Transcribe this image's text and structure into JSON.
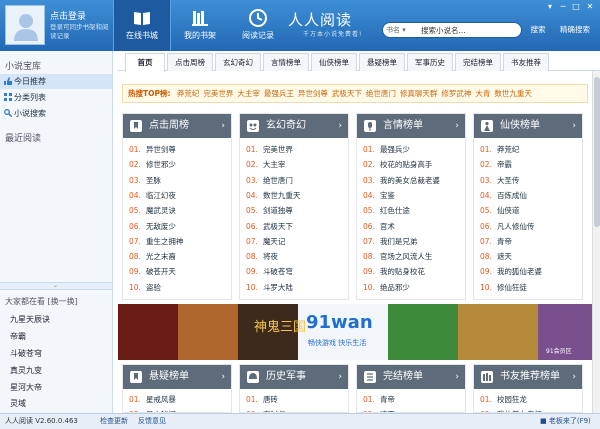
{
  "header": {
    "login_title": "点击登录",
    "login_sub": "登录可同步书架和阅读记录",
    "brand": "人人阅读",
    "brand_sub": "千万本小说免费看!",
    "nav": [
      {
        "label": "在线书城",
        "icon": "book-icon",
        "active": true
      },
      {
        "label": "我的书架",
        "icon": "bookshelf-icon",
        "active": false
      },
      {
        "label": "阅读记录",
        "icon": "clock-icon",
        "active": false
      }
    ],
    "search": {
      "scope": "书名 ▾",
      "value": "搜索小说名...",
      "search_label": "搜索",
      "exact_label": "精确搜索"
    },
    "window_controls": [
      "▾",
      "─",
      "□",
      "✕"
    ]
  },
  "sidebar": {
    "library_title": "小说宝库",
    "items": [
      {
        "label": "今日推荐",
        "icon": "thumbs-up-icon",
        "active": true
      },
      {
        "label": "分类列表",
        "icon": "grid-icon",
        "active": false
      },
      {
        "label": "小说搜索",
        "icon": "search-icon",
        "active": false
      }
    ],
    "recent_title": "最近阅读",
    "divider": "⌄",
    "hot_title": "大家都在看 [换一换]",
    "hot_items": [
      "九星天辰诀",
      "帝霸",
      "斗破苍穹",
      "真灵九变",
      "星河大帝",
      "灵域"
    ]
  },
  "tabs": [
    "首页",
    "点击周榜",
    "玄幻奇幻",
    "言情榜单",
    "仙侠榜单",
    "悬疑榜单",
    "军事历史",
    "完结榜单",
    "书友推荐"
  ],
  "hot_top": {
    "label": "热搜TOP榜:",
    "items": [
      "莽荒纪",
      "完美世界",
      "大主宰",
      "最强兵王",
      "异世剑尊",
      "武极天下",
      "绝世唐门",
      "修真聊天群",
      "修罗武神",
      "大青",
      "数世九重天"
    ]
  },
  "panels": [
    {
      "title": "点击周榜",
      "icon": "bookmark-icon",
      "items": [
        "异世剑尊",
        "修世邪少",
        "圣脉",
        "临江幻夜",
        "魔武灵诀",
        "无敌废少",
        "重生之拥神",
        "光之末裔",
        "破苍开天",
        "盗验"
      ]
    },
    {
      "title": "玄幻奇幻",
      "icon": "mask-icon",
      "items": [
        "完美世界",
        "大主宰",
        "绝世唐门",
        "数世九重天",
        "剑道独尊",
        "武极天下",
        "魔天记",
        "将夜",
        "斗破苍穹",
        "斗罗大陆"
      ]
    },
    {
      "title": "言情榜单",
      "icon": "microphone-icon",
      "items": [
        "最强兵少",
        "校花的贴身高手",
        "我的美女总裁老婆",
        "宝鉴",
        "红色仕途",
        "官术",
        "我们是兄弟",
        "官场之风流人生",
        "我的贴身校花",
        "绝品邪少"
      ]
    },
    {
      "title": "仙侠榜单",
      "icon": "figure-icon",
      "items": [
        "莽荒纪",
        "帝霸",
        "大圣传",
        "百炼成仙",
        "仙侠道",
        "凡人修仙传",
        "青帝",
        "遮天",
        "我的狐仙老婆",
        "修仙狂徒"
      ]
    }
  ],
  "bottom_panels": [
    {
      "title": "悬疑榜单",
      "icon": "bookmark-icon",
      "items": [
        "星戒风暴",
        "风水秘闻"
      ]
    },
    {
      "title": "历史军事",
      "icon": "helmet-icon",
      "items": [
        "唐砖",
        "宋时归"
      ]
    },
    {
      "title": "完结榜单",
      "icon": "list-icon",
      "items": [
        "青帝",
        "遮天"
      ]
    },
    {
      "title": "书友推荐榜单",
      "icon": "books-icon",
      "items": [
        "校园狂龙",
        "我的美女老师"
      ]
    }
  ],
  "banner": {
    "text1": "91wan",
    "text2": "畅快游戏 快乐生活",
    "text3": "神鬼三国",
    "badge": "91会员区"
  },
  "status": {
    "version": "人人阅读 V2.60.0.463",
    "update": "检查更新",
    "feedback": "反馈意见",
    "right": "■ 老板来了(F9)"
  },
  "colors": {
    "header": "#2f7cc8",
    "accent": "#e85a1c",
    "panel_head": "#5d6b7b"
  }
}
